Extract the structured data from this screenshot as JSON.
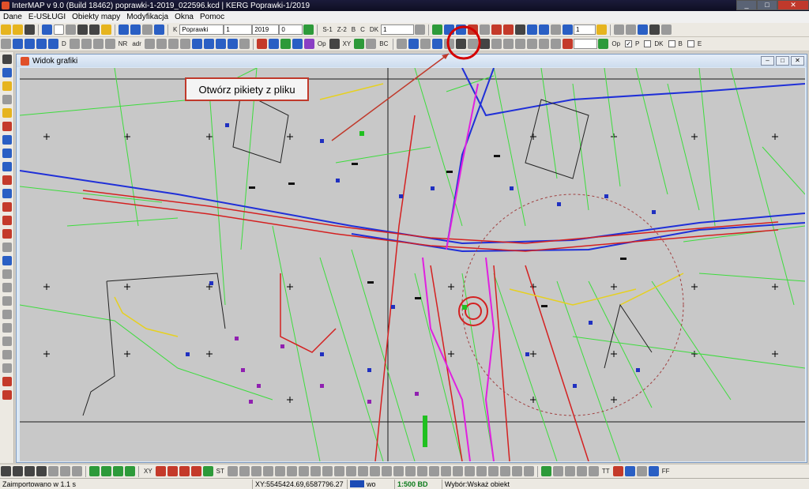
{
  "window": {
    "title": "InterMAP v 9.0 (Build 18462)   poprawki-1-2019_022596.kcd | KERG Poprawki-1/2019",
    "btn_min": "_",
    "btn_max": "□",
    "btn_close": "✕"
  },
  "menu": {
    "items": [
      "Dane",
      "E-USŁUGI",
      "Obiekty mapy",
      "Modyfikacja",
      "Okna",
      "Pomoc"
    ]
  },
  "toolbar1": {
    "layer_letter": "K",
    "layer_value": "Poprawki",
    "field2": "1",
    "year": "2019",
    "field4": "0",
    "labels": [
      "S-1",
      "Z-2",
      "B",
      "C",
      "DK"
    ],
    "scale_value": "1",
    "right_field": "1"
  },
  "toolbar2": {
    "labels": [
      "D",
      "NR",
      "adr",
      "Op",
      "XY",
      "BC",
      "Op"
    ],
    "check_labels": [
      "P",
      "DK",
      "B",
      "E"
    ]
  },
  "doc": {
    "title": "Widok grafiki",
    "btn_min": "–",
    "btn_max": "□",
    "btn_close": "✕"
  },
  "callout": {
    "text": "Otwórz pikiety z pliku"
  },
  "bottom_toolbar": {
    "labels": [
      "XY",
      "ST",
      "TT",
      "FF"
    ]
  },
  "status": {
    "message": "Zaimportowano w 1.1 s",
    "xy": "XY:5545424.69,6587796.27",
    "mode": "wo",
    "scale": "1:500 BD",
    "selection": "Wybór:Wskaż obiekt"
  },
  "colors": {
    "map_background": "#c8c8c8",
    "highlight_circle": "#d40000",
    "callout_border": "#c0392b"
  }
}
